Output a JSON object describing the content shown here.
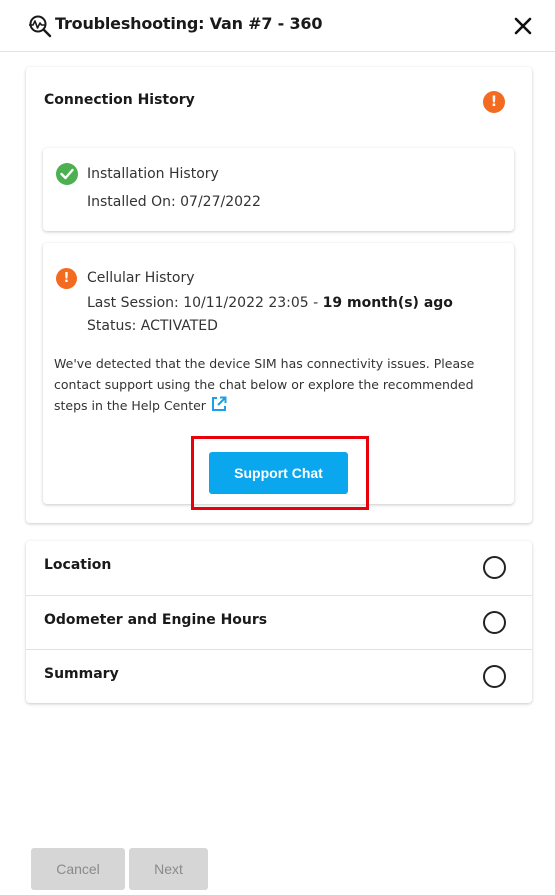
{
  "header": {
    "title": "Troubleshooting: Van #7 - 360",
    "icon": "search-diagnostic-icon",
    "close_icon": "close-icon"
  },
  "connection_history": {
    "title": "Connection History",
    "status_icon": "warning-icon",
    "installation": {
      "title": "Installation History",
      "installed_on": "Installed On: 07/27/2022",
      "status_icon": "check-circle-icon"
    },
    "cellular": {
      "title": "Cellular History",
      "last_session_prefix": "Last Session: 10/11/2022 23:05 - ",
      "last_session_ago": "19 month(s) ago",
      "status": "Status: ACTIVATED",
      "status_icon": "warning-icon",
      "description": "We've detected that the device SIM has connectivity issues. Please contact support using the chat below or explore the recommended steps in the Help Center",
      "external_link_icon": "external-link-icon",
      "support_button": "Support Chat"
    }
  },
  "steps": [
    {
      "label": "Location"
    },
    {
      "label": "Odometer and Engine Hours"
    },
    {
      "label": "Summary"
    }
  ],
  "footer": {
    "cancel": "Cancel",
    "next": "Next"
  },
  "colors": {
    "warning": "#f26b21",
    "success": "#4caf50",
    "primary": "#0aa6ee",
    "highlight": "#e8000b",
    "disabled": "#d6d6d6"
  }
}
